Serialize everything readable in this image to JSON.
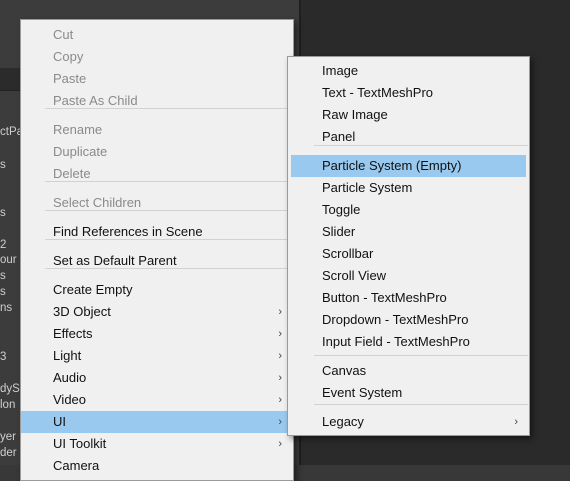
{
  "background_fragments": [
    "ctPa",
    "s",
    "s",
    "2",
    "our",
    "s",
    "s",
    "ns",
    "3",
    "dyS",
    "lon",
    "yer",
    "der"
  ],
  "main_menu": {
    "clipboard": [
      "Cut",
      "Copy",
      "Paste",
      "Paste As Child"
    ],
    "edit": [
      "Rename",
      "Duplicate",
      "Delete"
    ],
    "select_children": "Select Children",
    "find_references": "Find References in Scene",
    "set_default_parent": "Set as Default Parent",
    "create": [
      "Create Empty",
      "3D Object",
      "Effects",
      "Light",
      "Audio",
      "Video",
      "UI",
      "UI Toolkit",
      "Camera"
    ],
    "submenu_arrow": "›",
    "highlighted_item": "UI"
  },
  "ui_submenu": {
    "group1": [
      "Image",
      "Text - TextMeshPro",
      "Raw Image",
      "Panel"
    ],
    "group2": [
      "Particle System (Empty)",
      "Particle System",
      "Toggle",
      "Slider",
      "Scrollbar",
      "Scroll View",
      "Button - TextMeshPro",
      "Dropdown - TextMeshPro",
      "Input Field - TextMeshPro"
    ],
    "group3": [
      "Canvas",
      "Event System"
    ],
    "group4": [
      "Legacy"
    ],
    "submenu_arrow": "›",
    "highlighted_item": "Particle System (Empty)"
  },
  "colors": {
    "menu_bg": "#f0f0f0",
    "highlight": "#99c9ef",
    "disabled_text": "#8a8a8a",
    "editor_bg": "#3c3c3c"
  }
}
